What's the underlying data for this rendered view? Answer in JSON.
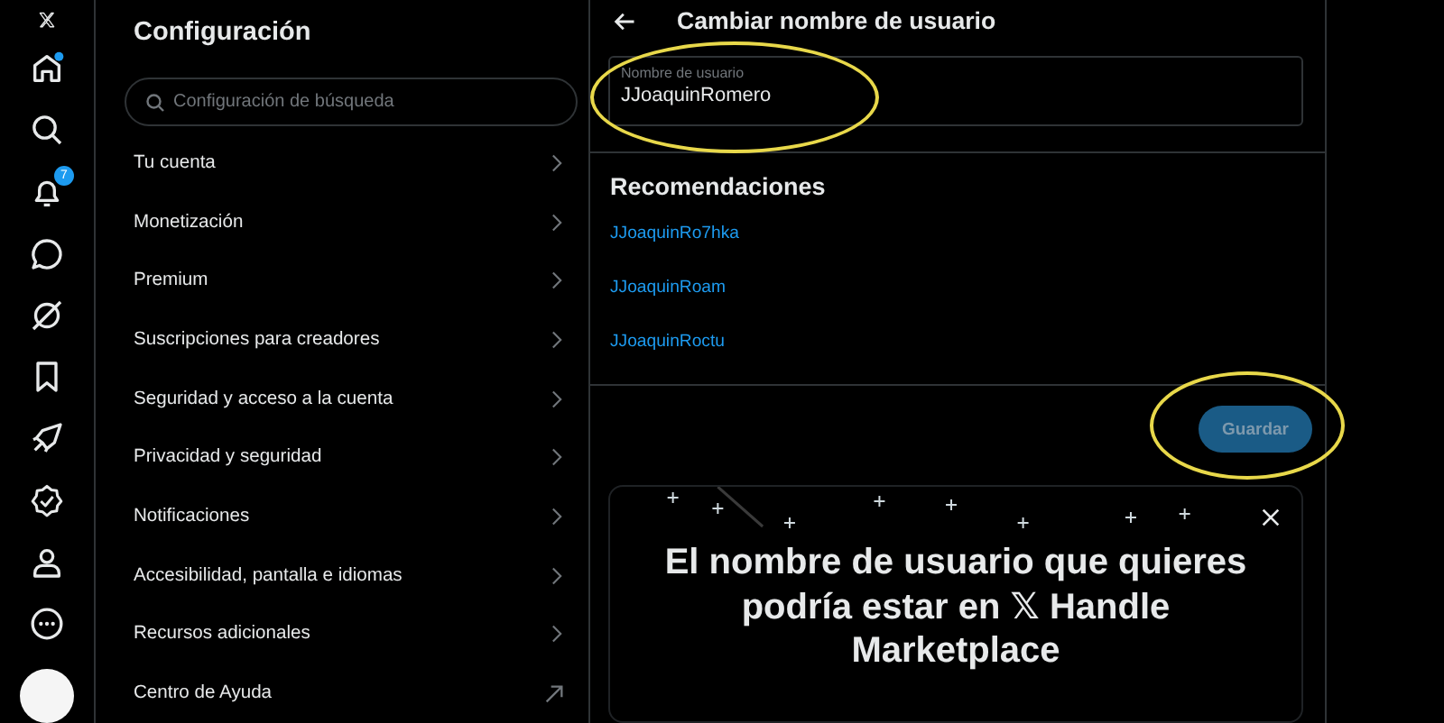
{
  "nav": {
    "notification_count": "7",
    "home_dot": true
  },
  "settings": {
    "title": "Configuración",
    "search": {
      "placeholder": "Configuración de búsqueda"
    },
    "items": [
      {
        "label": "Tu cuenta",
        "kind": "section"
      },
      {
        "label": "Monetización",
        "kind": "section"
      },
      {
        "label": "Premium",
        "kind": "section"
      },
      {
        "label": "Suscripciones para creadores",
        "kind": "section"
      },
      {
        "label": "Seguridad y acceso a la cuenta",
        "kind": "section"
      },
      {
        "label": "Privacidad y seguridad",
        "kind": "section"
      },
      {
        "label": "Notificaciones",
        "kind": "section"
      },
      {
        "label": "Accesibilidad, pantalla e idiomas",
        "kind": "section"
      },
      {
        "label": "Recursos adicionales",
        "kind": "section"
      },
      {
        "label": "Centro de Ayuda",
        "kind": "external"
      }
    ]
  },
  "panel": {
    "title": "Cambiar nombre de usuario",
    "field": {
      "label": "Nombre de usuario",
      "value": "JJoaquinRomero"
    },
    "recommendations_title": "Recomendaciones",
    "recommendations": [
      "JJoaquinRo7hka",
      "JJoaquinRoam",
      "JJoaquinRoctu"
    ],
    "save_button": {
      "label": "Guardar",
      "disabled": true
    },
    "promo": {
      "text_before": "El nombre de usuario que quieres podría estar en",
      "logo": "𝕏",
      "text_after": "Handle Marketplace"
    }
  }
}
